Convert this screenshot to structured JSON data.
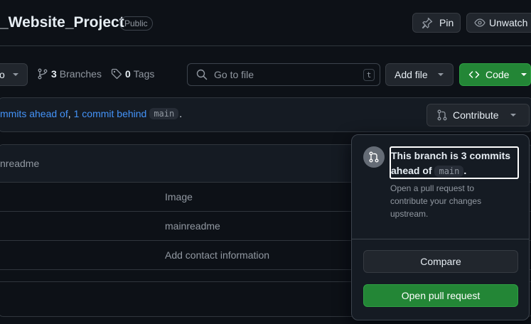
{
  "repo": {
    "name": "_Website_Project",
    "visibility": "Public"
  },
  "header": {
    "pin_label": "Pin",
    "unwatch_label": "Unwatch"
  },
  "toolbar": {
    "branch_label": "o",
    "branches_count": "3",
    "branches_label": "Branches",
    "tags_count": "0",
    "tags_label": "Tags",
    "goto_placeholder": "Go to file",
    "goto_key": "t",
    "add_file_label": "Add file",
    "code_label": "Code"
  },
  "status": {
    "ahead_text": "mmits ahead of",
    "comma": ",",
    "behind_text": "1 commit behind",
    "base_branch": "main",
    "period": ".",
    "contribute_label": "Contribute"
  },
  "files": {
    "latest_commit": "nreadme",
    "rows": [
      {
        "message": "Image"
      },
      {
        "message": "mainreadme"
      },
      {
        "message": "Add contact information"
      }
    ]
  },
  "popover": {
    "title_part1": "This branch is 3 commits",
    "title_part2": "ahead of",
    "base_branch": "main",
    "title_end": ".",
    "description": "Open a pull request to contribute your changes upstream.",
    "compare_label": "Compare",
    "open_pr_label": "Open pull request"
  },
  "colors": {
    "accent_link": "#4493f8",
    "primary_green": "#238636",
    "canvas": "#0d1117"
  }
}
